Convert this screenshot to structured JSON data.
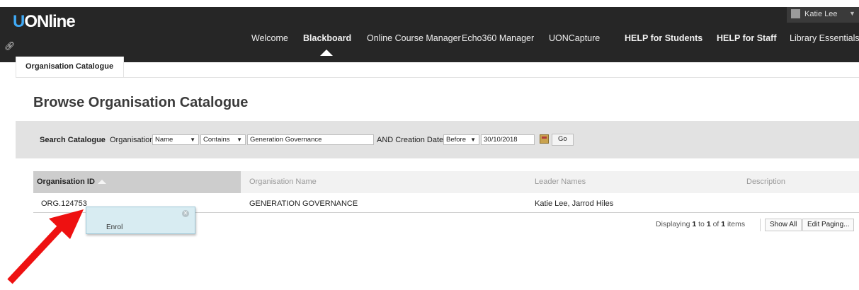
{
  "header": {
    "logo_u": "U",
    "logo_rest": "ONline",
    "user_name": "Katie Lee",
    "nav": [
      {
        "label": "Welcome"
      },
      {
        "label": "Blackboard"
      },
      {
        "label": "Online Course Manager"
      },
      {
        "label": "Echo360 Manager"
      },
      {
        "label": "UONCapture"
      },
      {
        "label": "HELP for Students"
      },
      {
        "label": "HELP for Staff"
      },
      {
        "label": "Library Essentials"
      }
    ]
  },
  "tabs": [
    {
      "label": "Organisation Catalogue"
    }
  ],
  "page": {
    "title": "Browse Organisation Catalogue"
  },
  "search": {
    "label": "Search Catalogue",
    "field_label": "Organisation",
    "field_value": "Name",
    "operator_value": "Contains",
    "query_value": "Generation Governance",
    "date_label": "AND Creation Date",
    "date_operator_value": "Before",
    "date_value": "30/10/2018",
    "go_label": "Go"
  },
  "table": {
    "columns": [
      "Organisation ID",
      "Organisation Name",
      "Leader Names",
      "Description"
    ],
    "rows": [
      {
        "id": "ORG.124753",
        "name": "GENERATION GOVERNANCE",
        "leaders": "Katie Lee, Jarrod Hiles",
        "description": ""
      }
    ]
  },
  "paging": {
    "prefix": "Displaying",
    "from": "1",
    "to_word": "to",
    "to": "1",
    "of_word": "of",
    "total": "1",
    "suffix": "items",
    "show_all_label": "Show All",
    "edit_paging_label": "Edit Paging..."
  },
  "popup": {
    "item_label": "Enrol"
  },
  "colors": {
    "topbar": "#262626",
    "accent": "#3fa9f5",
    "arrow": "#ee1111"
  }
}
